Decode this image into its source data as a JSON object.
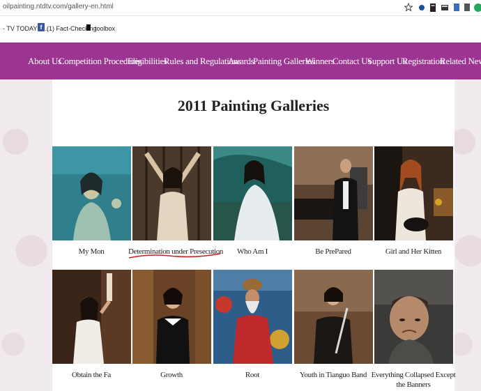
{
  "browser": {
    "url": "oilpainting.ntdtv.com/gallery-en.html",
    "bookmarks": [
      "- TV TODAY N...",
      "(1) Fact-Checking",
      "toolbox"
    ],
    "icons": [
      "star-icon",
      "extension-icon",
      "extension-icon",
      "extension-icon",
      "extension-icon",
      "extension-icon",
      "extension-icon"
    ]
  },
  "nav": {
    "items": [
      "About Us",
      "Competition Procedures",
      "Eligibilities",
      "Rules and Regulations",
      "Awards",
      "Painting Galleries",
      "Winners",
      "Contact Us",
      "Support Us",
      "Registration",
      "Related News"
    ],
    "color": "#9b3591"
  },
  "page": {
    "title": "2011 Painting Galleries"
  },
  "gallery": [
    {
      "caption": "My Mon"
    },
    {
      "caption": "Determination under Presecution"
    },
    {
      "caption": "Who Am I"
    },
    {
      "caption": "Be PrePared"
    },
    {
      "caption": "Girl and Her Kitten"
    },
    {
      "caption": "Obtain the Fa"
    },
    {
      "caption": "Growth"
    },
    {
      "caption": "Root"
    },
    {
      "caption": "Youth in Tianguo Band"
    },
    {
      "caption": "Everything Collapsed Except the Banners"
    }
  ]
}
